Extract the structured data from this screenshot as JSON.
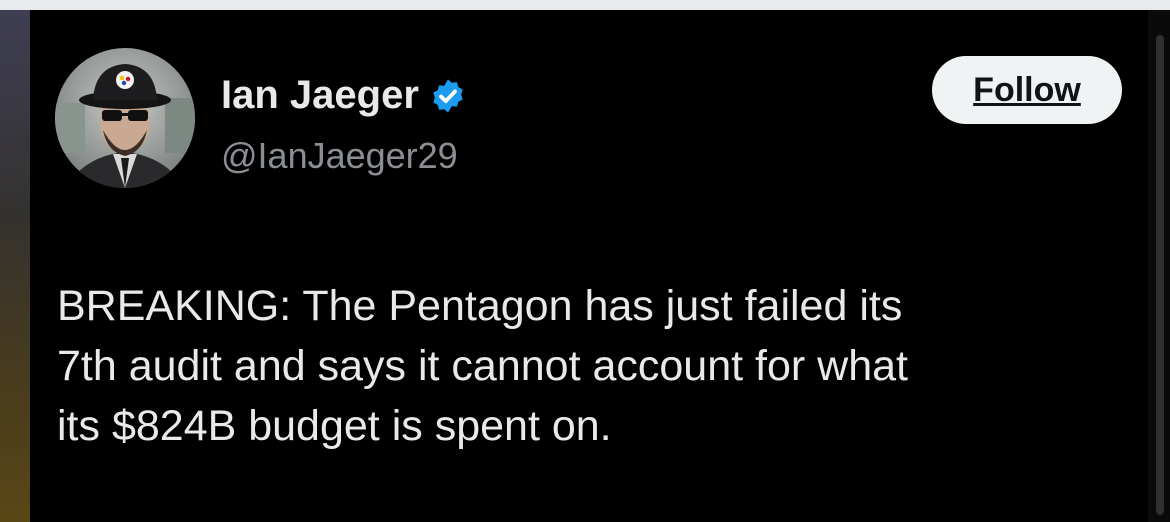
{
  "tweet": {
    "author_name": "Ian Jaeger",
    "handle": "@IanJaeger29",
    "verified_icon": "verified-badge-icon",
    "follow_label": "Follow",
    "text_lines": [
      "BREAKING: The Pentagon has just failed its",
      "7th audit and says it cannot account for what",
      "its $824B budget is spent on."
    ]
  },
  "colors": {
    "background": "#000000",
    "text": "#e7e9ea",
    "handle": "#8b8f94",
    "verified": "#1d9bf0",
    "follow_bg": "#eff3f4"
  }
}
